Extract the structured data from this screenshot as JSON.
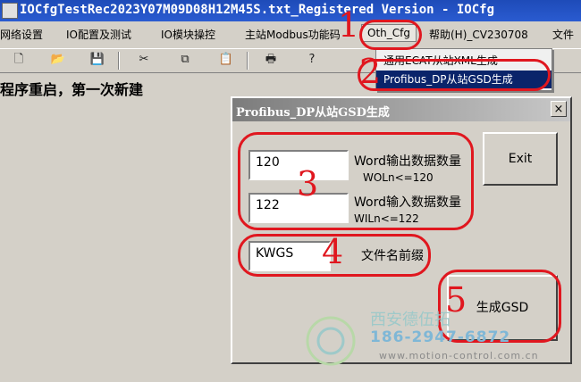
{
  "window": {
    "title": "IOCfgTestRec2023Y07M09D08H12M45S.txt_Registered Version - IOCfg"
  },
  "menu": {
    "items": [
      "网络设置",
      "IO配置及测试",
      "IO模块操控",
      "主站Modbus功能码",
      "Oth_Cfg",
      "帮助(H)_CV230708",
      "文件"
    ]
  },
  "toolbar": {
    "icons": [
      "new-file-icon",
      "open-folder-icon",
      "save-icon",
      "cut-icon",
      "copy-icon",
      "paste-icon",
      "print-icon",
      "help-icon"
    ],
    "glyphs": [
      "🗋",
      "📂",
      "💾",
      "✂",
      "⧉",
      "📋",
      "🖶",
      "?"
    ]
  },
  "status": {
    "text": "程序重启，第一次新建"
  },
  "dropdown": {
    "items": [
      "通用ECAT从站XML生成",
      "Profibus_DP从站GSD生成"
    ]
  },
  "dialog": {
    "title": "Profibus_DP从站GSD生成",
    "close": "×",
    "word_out_value": "120",
    "word_out_label": "Word输出数据数量",
    "word_out_limit": "WOLn<=120",
    "word_in_value": "122",
    "word_in_label": "Word输入数据数量",
    "word_in_limit": "WILn<=122",
    "prefix_value": "KWGS",
    "prefix_label": "文件名前缀",
    "exit_button": "Exit",
    "generate_button": "生成GSD"
  },
  "annotations": [
    "1",
    "2",
    "3",
    "4",
    "5"
  ],
  "watermark": {
    "company": "西安德伍拓",
    "phone": "186-2947-6872",
    "url": "www.motion-control.com.cn"
  },
  "colors": {
    "annotation": "#e0171f",
    "menu_highlight": "#0a246a",
    "titlebar": "#1e4bb8"
  }
}
